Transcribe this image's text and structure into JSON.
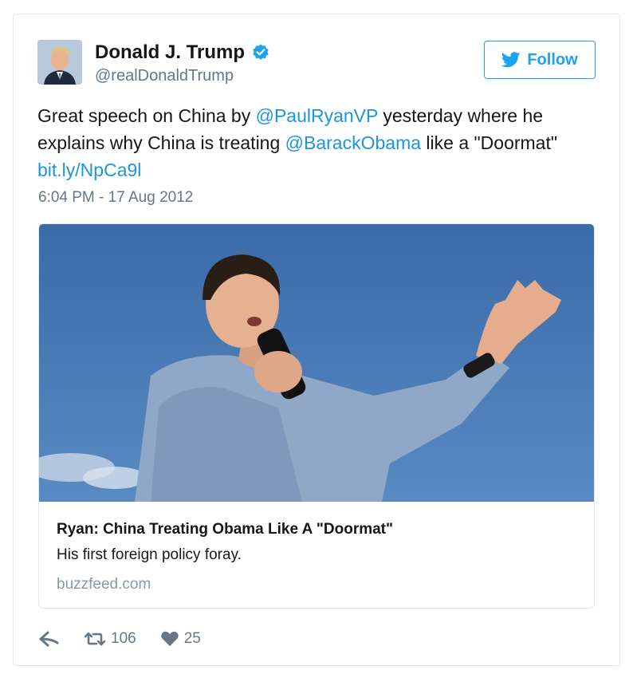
{
  "user": {
    "display_name": "Donald J. Trump",
    "screen_name": "@realDonaldTrump",
    "verified_icon": "verified-badge-icon"
  },
  "follow_button": {
    "label": "Follow",
    "icon": "twitter-bird-icon"
  },
  "tweet": {
    "text_part1": "Great speech on China by ",
    "mention1": "@PaulRyanVP",
    "text_part2": " yesterday where he explains why China is treating ",
    "mention2": "@BarackObama",
    "text_part3": " like a \"Doormat\" ",
    "link": "bit.ly/NpCa9l",
    "timestamp": "6:04 PM - 17 Aug 2012"
  },
  "card": {
    "title": "Ryan: China Treating Obama Like A \"Doormat\"",
    "description": "His first foreign policy foray.",
    "domain": "buzzfeed.com"
  },
  "actions": {
    "reply_icon": "reply-icon",
    "retweet_icon": "retweet-icon",
    "retweet_count": "106",
    "like_icon": "heart-icon",
    "like_count": "25"
  },
  "colors": {
    "accent": "#1da1f2",
    "link": "#1b95e0",
    "muted": "#657786",
    "border": "#e1e8ed"
  }
}
